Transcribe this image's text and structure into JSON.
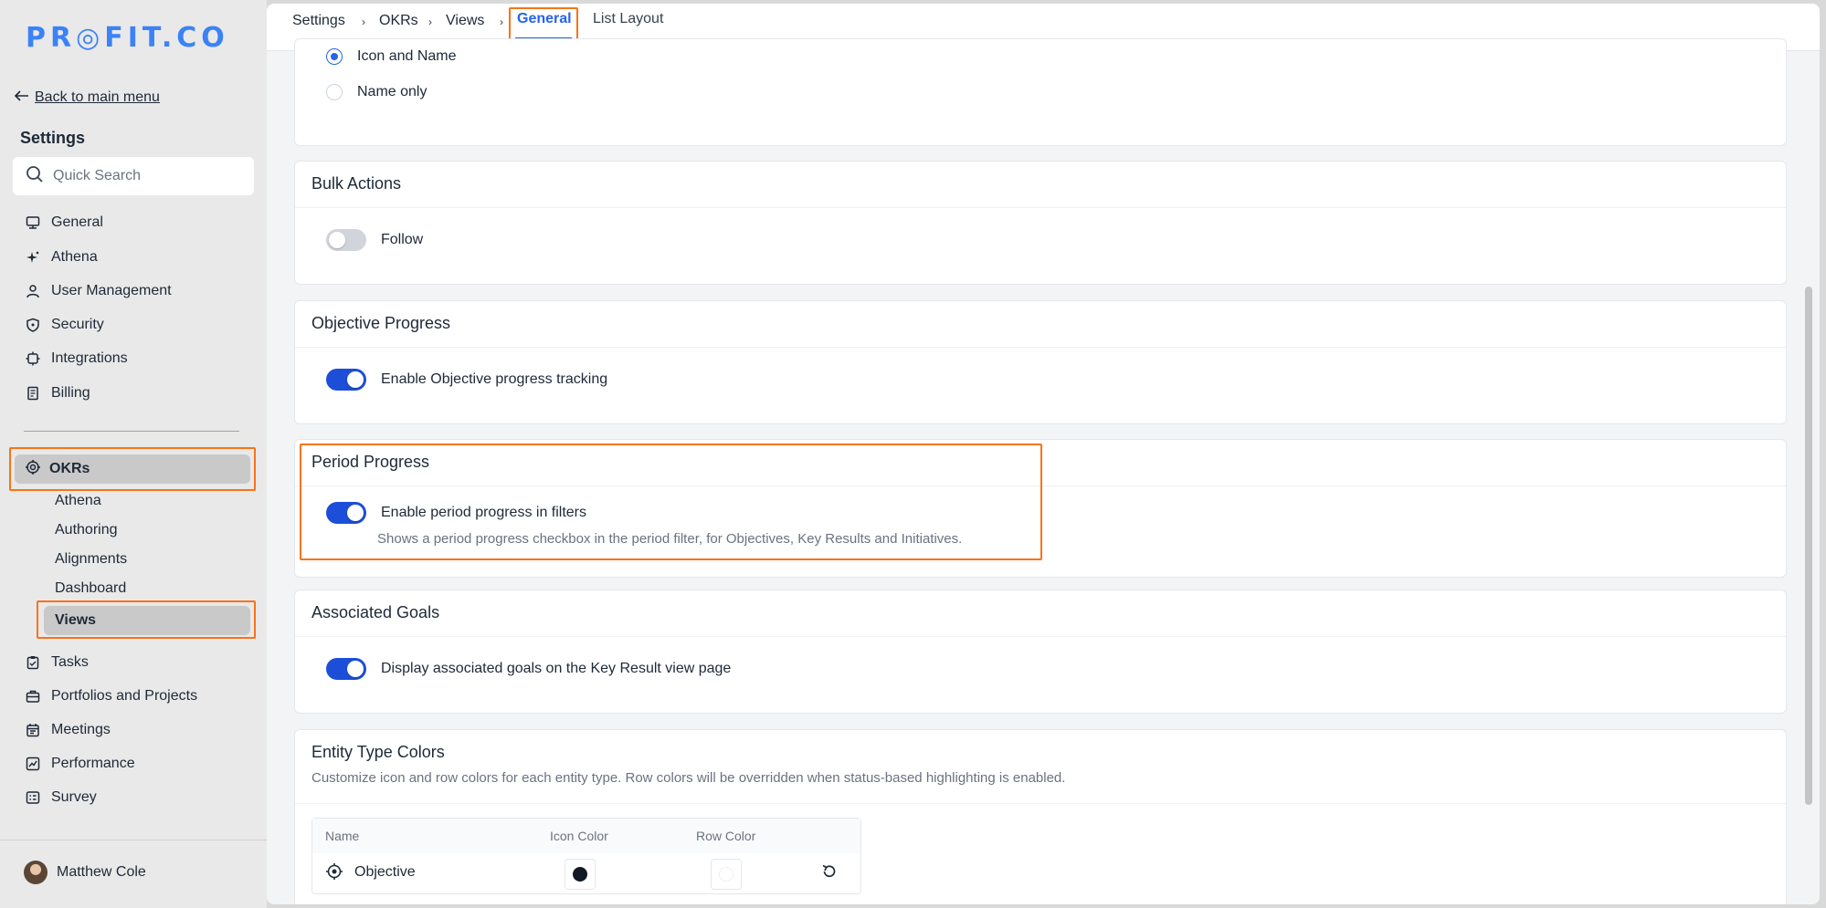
{
  "brand": {
    "logo_text": "PR◎FIT.CO"
  },
  "sidebar": {
    "back_label": "Back to main menu",
    "title": "Settings",
    "search_placeholder": "Quick Search",
    "items": [
      {
        "label": "General",
        "icon": "monitor-icon"
      },
      {
        "label": "Athena",
        "icon": "sparkle-icon"
      },
      {
        "label": "User Management",
        "icon": "user-icon"
      },
      {
        "label": "Security",
        "icon": "shield-icon"
      },
      {
        "label": "Integrations",
        "icon": "plug-icon"
      },
      {
        "label": "Billing",
        "icon": "receipt-icon"
      }
    ],
    "okrs": {
      "label": "OKRs",
      "icon": "target-icon",
      "children": [
        "Athena",
        "Authoring",
        "Alignments",
        "Dashboard",
        "Views"
      ]
    },
    "items_after": [
      {
        "label": "Tasks",
        "icon": "clipboard-icon"
      },
      {
        "label": "Portfolios and Projects",
        "icon": "briefcase-icon"
      },
      {
        "label": "Meetings",
        "icon": "calendar-icon"
      },
      {
        "label": "Performance",
        "icon": "chart-icon"
      },
      {
        "label": "Survey",
        "icon": "survey-icon"
      }
    ],
    "user_name": "Matthew Cole"
  },
  "breadcrumb": {
    "items": [
      "Settings",
      "OKRs",
      "Views"
    ],
    "separator": "›",
    "active_tab": "General",
    "other_tab": "List Layout"
  },
  "display": {
    "options": [
      "Icon and Name",
      "Name only"
    ],
    "selected": "Icon and Name"
  },
  "bulk_actions": {
    "title": "Bulk Actions",
    "toggle_label": "Follow",
    "enabled": false
  },
  "objective_progress": {
    "title": "Objective Progress",
    "toggle_label": "Enable Objective progress tracking",
    "enabled": true
  },
  "period_progress": {
    "title": "Period Progress",
    "toggle_label": "Enable period progress in filters",
    "description": "Shows a period progress checkbox in the period filter, for Objectives, Key Results and Initiatives.",
    "enabled": true
  },
  "associated_goals": {
    "title": "Associated Goals",
    "toggle_label": "Display associated goals on the Key Result view page",
    "enabled": true
  },
  "entity_colors": {
    "title": "Entity Type Colors",
    "description": "Customize icon and row colors for each entity type. Row colors will be overridden when status-based highlighting is enabled.",
    "columns": [
      "Name",
      "Icon Color",
      "Row Color"
    ],
    "rows": [
      {
        "name": "Objective",
        "icon": "objective-target-icon",
        "icon_color": "#111827",
        "row_color": "#ffffff"
      }
    ]
  },
  "colors": {
    "accent": "#2563eb",
    "highlight": "#f97316",
    "brand": "#3b82f6"
  }
}
